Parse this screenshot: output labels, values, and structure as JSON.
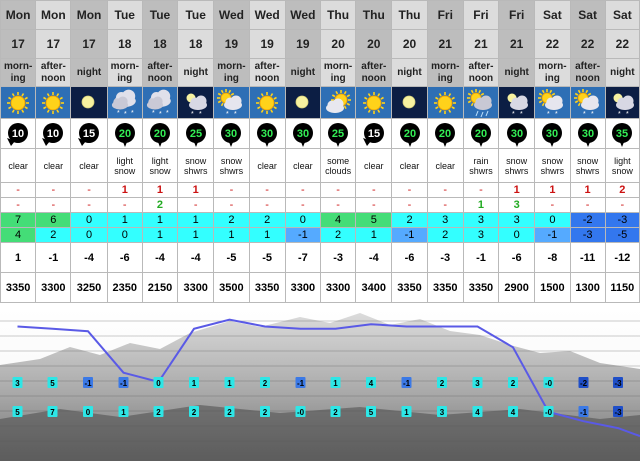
{
  "columns": [
    {
      "day": "Mon",
      "date": "17",
      "period": "morning",
      "condition": "clear",
      "wind": "10",
      "precip_rain": "-",
      "precip_snow": "-",
      "temp_max": "7",
      "temp_min": "4",
      "feels": "1",
      "freezing_level": "3350",
      "icon": "sun-icon"
    },
    {
      "day": "Mon",
      "date": "17",
      "period": "afternoon",
      "condition": "clear",
      "wind": "10",
      "precip_rain": "-",
      "precip_snow": "-",
      "temp_max": "6",
      "temp_min": "2",
      "feels": "-1",
      "freezing_level": "3300",
      "icon": "sun-icon"
    },
    {
      "day": "Mon",
      "date": "17",
      "period": "night",
      "condition": "clear",
      "wind": "15",
      "precip_rain": "-",
      "precip_snow": "-",
      "temp_max": "0",
      "temp_min": "0",
      "feels": "-4",
      "freezing_level": "3250",
      "icon": "moon-icon"
    },
    {
      "day": "Tue",
      "date": "18",
      "period": "morning",
      "condition": "light snow",
      "wind": "20",
      "precip_rain": "1",
      "precip_snow": "-",
      "temp_max": "1",
      "temp_min": "0",
      "feels": "-6",
      "freezing_level": "2350",
      "icon": "snow-cloud-icon"
    },
    {
      "day": "Tue",
      "date": "18",
      "period": "afternoon",
      "condition": "light snow",
      "wind": "20",
      "precip_rain": "1",
      "precip_snow": "2",
      "temp_max": "1",
      "temp_min": "1",
      "feels": "-4",
      "freezing_level": "2150",
      "icon": "snow-cloud-icon"
    },
    {
      "day": "Tue",
      "date": "18",
      "period": "night",
      "condition": "snow shwrs",
      "wind": "25",
      "precip_rain": "1",
      "precip_snow": "-",
      "temp_max": "1",
      "temp_min": "1",
      "feels": "-4",
      "freezing_level": "3300",
      "icon": "snow-shower-night-icon"
    },
    {
      "day": "Wed",
      "date": "19",
      "period": "morning",
      "condition": "snow shwrs",
      "wind": "30",
      "precip_rain": "-",
      "precip_snow": "-",
      "temp_max": "2",
      "temp_min": "1",
      "feels": "-5",
      "freezing_level": "3500",
      "icon": "snow-shower-icon"
    },
    {
      "day": "Wed",
      "date": "19",
      "period": "afternoon",
      "condition": "clear",
      "wind": "30",
      "precip_rain": "-",
      "precip_snow": "-",
      "temp_max": "2",
      "temp_min": "1",
      "feels": "-5",
      "freezing_level": "3350",
      "icon": "sun-icon"
    },
    {
      "day": "Wed",
      "date": "19",
      "period": "night",
      "condition": "clear",
      "wind": "30",
      "precip_rain": "-",
      "precip_snow": "-",
      "temp_max": "0",
      "temp_min": "-1",
      "feels": "-7",
      "freezing_level": "3300",
      "icon": "moon-icon"
    },
    {
      "day": "Thu",
      "date": "20",
      "period": "morning",
      "condition": "some clouds",
      "wind": "25",
      "precip_rain": "-",
      "precip_snow": "-",
      "temp_max": "4",
      "temp_min": "2",
      "feels": "-3",
      "freezing_level": "3300",
      "icon": "sun-cloud-icon"
    },
    {
      "day": "Thu",
      "date": "20",
      "period": "afternoon",
      "condition": "clear",
      "wind": "15",
      "precip_rain": "-",
      "precip_snow": "-",
      "temp_max": "5",
      "temp_min": "1",
      "feels": "-4",
      "freezing_level": "3400",
      "icon": "sun-icon"
    },
    {
      "day": "Thu",
      "date": "20",
      "period": "night",
      "condition": "clear",
      "wind": "20",
      "precip_rain": "-",
      "precip_snow": "-",
      "temp_max": "2",
      "temp_min": "-1",
      "feels": "-6",
      "freezing_level": "3350",
      "icon": "moon-icon"
    },
    {
      "day": "Fri",
      "date": "21",
      "period": "morning",
      "condition": "clear",
      "wind": "20",
      "precip_rain": "-",
      "precip_snow": "-",
      "temp_max": "3",
      "temp_min": "2",
      "feels": "-3",
      "freezing_level": "3350",
      "icon": "sun-icon"
    },
    {
      "day": "Fri",
      "date": "21",
      "period": "afternoon",
      "condition": "rain shwrs",
      "wind": "20",
      "precip_rain": "-",
      "precip_snow": "1",
      "temp_max": "3",
      "temp_min": "3",
      "feels": "-1",
      "freezing_level": "3350",
      "icon": "rain-shower-icon"
    },
    {
      "day": "Fri",
      "date": "21",
      "period": "night",
      "condition": "snow shwrs",
      "wind": "30",
      "precip_rain": "1",
      "precip_snow": "3",
      "temp_max": "3",
      "temp_min": "0",
      "feels": "-6",
      "freezing_level": "2900",
      "icon": "snow-shower-night-icon"
    },
    {
      "day": "Sat",
      "date": "22",
      "period": "morning",
      "condition": "snow shwrs",
      "wind": "30",
      "precip_rain": "1",
      "precip_snow": "-",
      "temp_max": "0",
      "temp_min": "-1",
      "feels": "-8",
      "freezing_level": "1500",
      "icon": "snow-shower-icon"
    },
    {
      "day": "Sat",
      "date": "22",
      "period": "afternoon",
      "condition": "snow shwrs",
      "wind": "30",
      "precip_rain": "1",
      "precip_snow": "-",
      "temp_max": "-2",
      "temp_min": "-3",
      "feels": "-11",
      "freezing_level": "1300",
      "icon": "snow-shower-icon"
    },
    {
      "day": "Sat",
      "date": "22",
      "period": "night",
      "condition": "light snow",
      "wind": "35",
      "precip_rain": "2",
      "precip_snow": "-",
      "temp_max": "-3",
      "temp_min": "-5",
      "feels": "-12",
      "freezing_level": "1150",
      "icon": "snow-shower-night-icon"
    }
  ],
  "chart": {
    "line_values": [
      3350,
      3300,
      3250,
      2350,
      2150,
      3300,
      3500,
      3350,
      3300,
      3300,
      3400,
      3350,
      3350,
      3350,
      2900,
      1500,
      1300,
      1150
    ],
    "row1_labels": [
      "3",
      "5",
      "-1",
      "-1",
      "0",
      "1",
      "1",
      "2",
      "-1",
      "1",
      "4",
      "-1",
      "2",
      "3",
      "2",
      "-0",
      "-2",
      "-3"
    ],
    "row2_labels": [
      "5",
      "7",
      "0",
      "1",
      "2",
      "2",
      "2",
      "2",
      "-0",
      "2",
      "5",
      "1",
      "3",
      "4",
      "4",
      "-0",
      "-1",
      "-3"
    ],
    "colors": {
      "line": "#5a5ae6",
      "chip_cyan": "#2ee6e6",
      "chip_blue": "#3b79e6",
      "chip_deep": "#1f4fc8"
    }
  },
  "colors": {
    "cyan": "#33ffff",
    "green": "#44dd77",
    "light_blue": "#55aaff",
    "blue": "#3377ee"
  }
}
